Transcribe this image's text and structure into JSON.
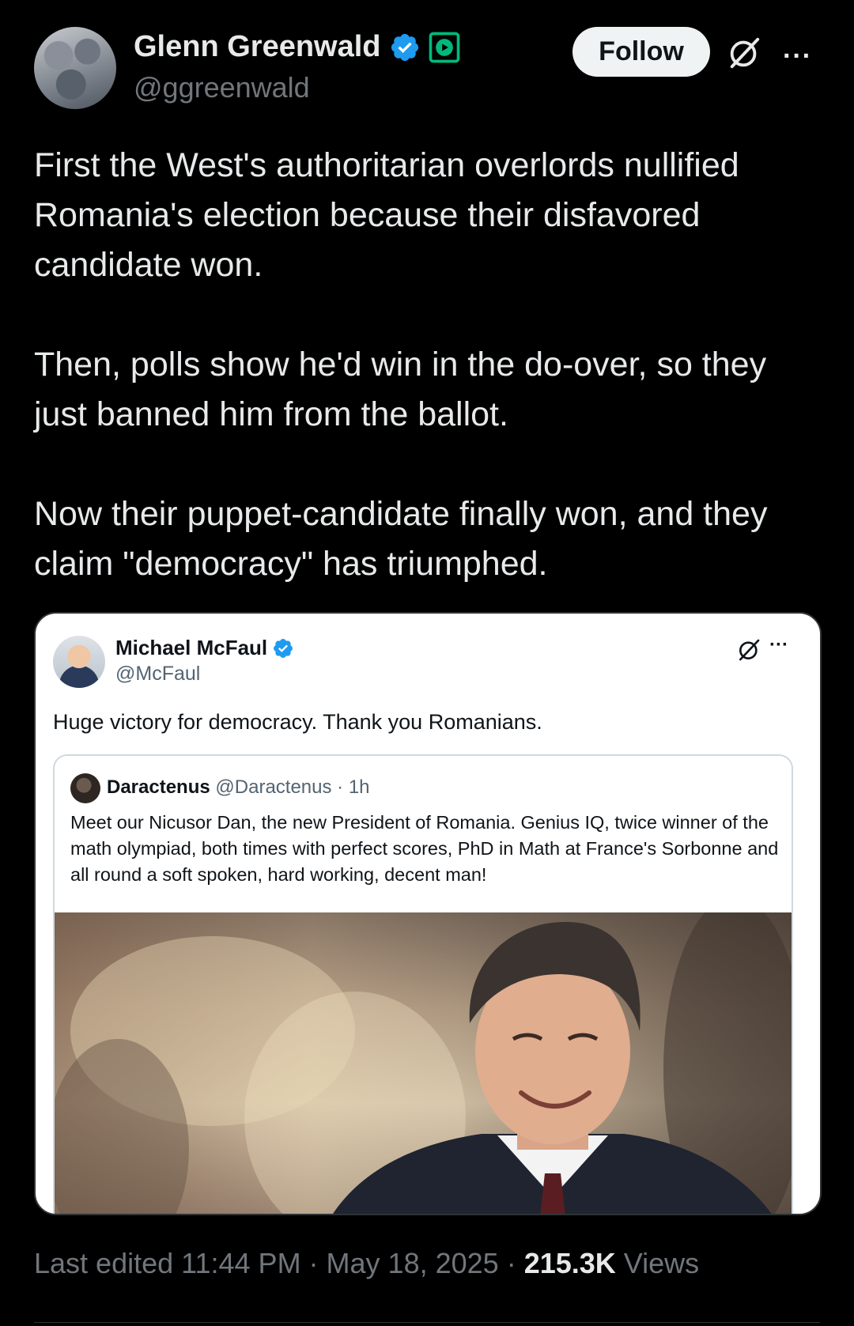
{
  "author": {
    "display_name": "Glenn Greenwald",
    "handle": "@ggreenwald",
    "verified_icon": "verified-badge-icon",
    "media_badge_icon": "play-badge-icon"
  },
  "actions": {
    "follow_label": "Follow",
    "grok_icon": "grok-icon",
    "more_icon": "more-icon",
    "more_glyph": "···"
  },
  "tweet": {
    "paragraphs": [
      "First the West's authoritarian overlords nullified Romania's election because their disfavored candidate won.",
      "Then, polls show he'd win in the do-over,  so they just banned him from the ballot.",
      "Now their puppet-candidate finally won, and they claim \"democracy\" has triumphed."
    ]
  },
  "quoted": {
    "display_name": "Michael McFaul",
    "handle": "@McFaul",
    "text": "Huge victory for democracy. Thank you Romanians.",
    "more_glyph": "···",
    "inner": {
      "display_name": "Daractenus",
      "handle": "@Daractenus",
      "time": "· 1h",
      "text": "Meet our Nicusor Dan, the new President of Romania. Genius IQ, twice winner of the math olympiad, both times with perfect scores, PhD in Math at France's Sorbonne and all round a soft spoken, hard working, decent man!"
    }
  },
  "meta": {
    "prefix": "Last edited 11:44 PM · May 18, 2025 · ",
    "views_count": "215.3K",
    "views_label": " Views"
  },
  "colors": {
    "background": "#000000",
    "text": "#e7e9ea",
    "muted": "#71767b",
    "verified_blue": "#1d9bf0",
    "badge_green": "#00ba7c"
  }
}
